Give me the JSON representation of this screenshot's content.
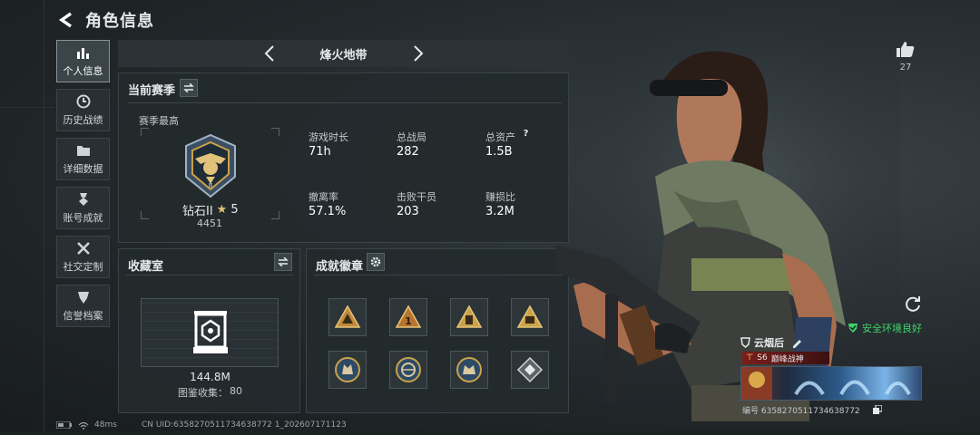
{
  "header": {
    "title": "角色信息"
  },
  "sidebar": {
    "items": [
      {
        "label": "个人信息",
        "icon": "bar-chart-icon"
      },
      {
        "label": "历史战绩",
        "icon": "clock-icon"
      },
      {
        "label": "详细数据",
        "icon": "folder-icon"
      },
      {
        "label": "账号成就",
        "icon": "medal-icon"
      },
      {
        "label": "社交定制",
        "icon": "tools-icon"
      },
      {
        "label": "信誉档案",
        "icon": "shield-icon"
      }
    ]
  },
  "mode": {
    "name": "烽火地带"
  },
  "season": {
    "title": "当前赛季",
    "best_label": "赛季最高",
    "rank": "钻石II",
    "stars": "5",
    "points": "4451",
    "stats": [
      {
        "label": "游戏时长",
        "value": "71h"
      },
      {
        "label": "总战局",
        "value": "282"
      },
      {
        "label": "总资产",
        "value": "1.5B"
      },
      {
        "label": "撤离率",
        "value": "57.1%"
      },
      {
        "label": "击败干员",
        "value": "203"
      },
      {
        "label": "赚损比",
        "value": "3.2M"
      }
    ],
    "help_icon": "?"
  },
  "collection": {
    "title": "收藏室",
    "value": "144.8M",
    "label": "图鉴收集：",
    "count": "80"
  },
  "achievements": {
    "title": "成就徽章"
  },
  "like": {
    "count": "27"
  },
  "env": {
    "text": "安全环境良好"
  },
  "player": {
    "name": "云烟后",
    "title_num": "S6",
    "title_text": "巅峰战神",
    "id_label": "编号 6358270511734638772"
  },
  "footer": {
    "ping": "48ms",
    "uid": "CN UID:6358270511734638772 1_202607171123"
  },
  "colors": {
    "accent": "#3fd46a",
    "gold": "#d9a84a",
    "title_red": "#7a1e1a"
  }
}
